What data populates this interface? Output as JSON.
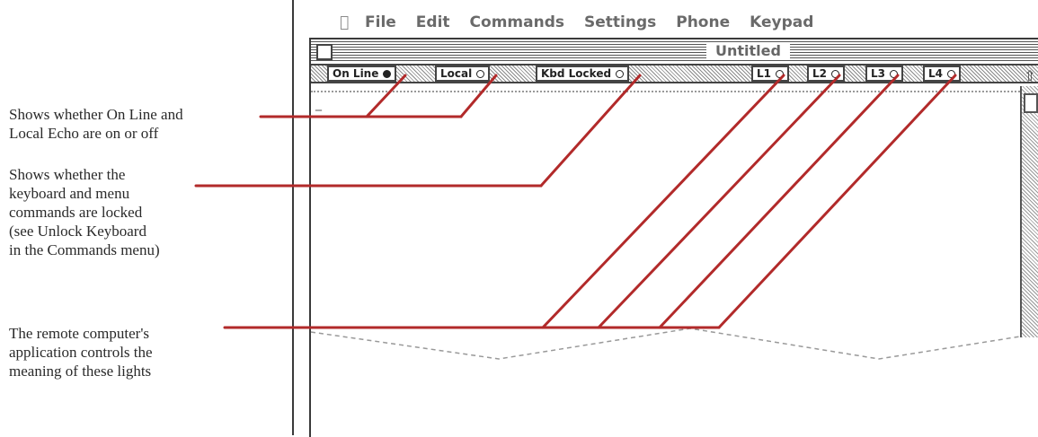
{
  "callouts": {
    "online_local": [
      "Shows whether On Line and",
      "Local Echo are on or off"
    ],
    "keyboard_lock": [
      "Shows whether the",
      "keyboard and menu",
      "commands are locked",
      "(see Unlock Keyboard",
      "in the Commands menu)"
    ],
    "remote_lights": [
      "The remote computer's",
      "application controls the",
      "meaning of these lights"
    ]
  },
  "menubar": {
    "apple_icon": "apple-icon",
    "items": [
      "File",
      "Edit",
      "Commands",
      "Settings",
      "Phone",
      "Keypad"
    ]
  },
  "window": {
    "title": "Untitled"
  },
  "status_lights": [
    {
      "label": "On Line",
      "state": "on"
    },
    {
      "label": "Local",
      "state": "off"
    },
    {
      "label": "Kbd Locked",
      "state": "off"
    },
    {
      "label": "L1",
      "state": "off"
    },
    {
      "label": "L2",
      "state": "off"
    },
    {
      "label": "L3",
      "state": "off"
    },
    {
      "label": "L4",
      "state": "off"
    }
  ],
  "terminal": {
    "cursor": "_"
  },
  "colors": {
    "callout_line": "#b22a2a",
    "frame": "#3a3a3a",
    "menu_text": "#6a6a6a"
  }
}
